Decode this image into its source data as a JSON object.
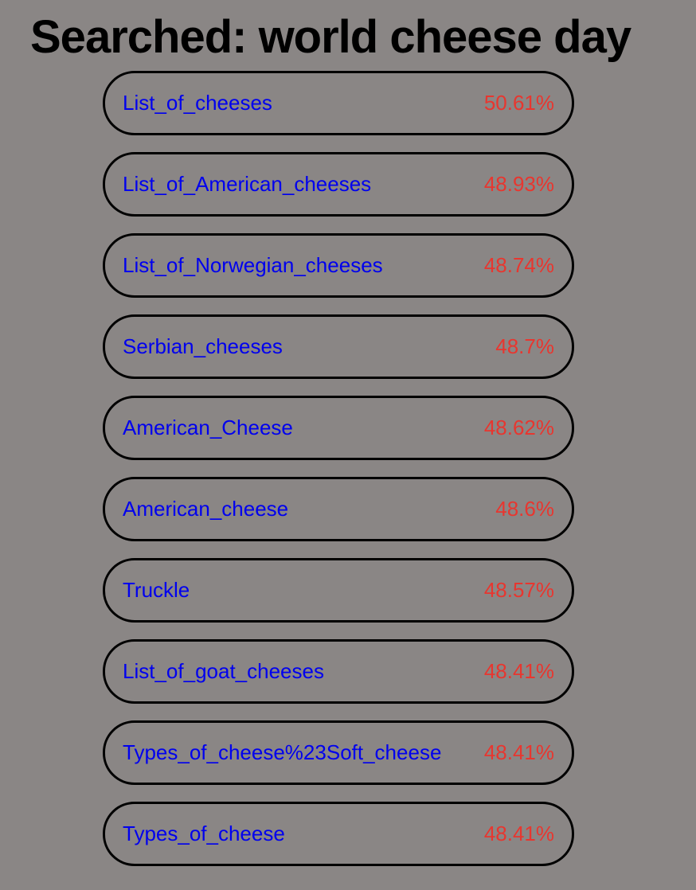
{
  "header": {
    "title": "Searched: world cheese day"
  },
  "colors": {
    "background": "#8a8685",
    "link": "#0000ee",
    "score": "#e8362f",
    "border": "#000000"
  },
  "results": [
    {
      "title": "List_of_cheeses",
      "score": "50.61%"
    },
    {
      "title": "List_of_American_cheeses",
      "score": "48.93%"
    },
    {
      "title": "List_of_Norwegian_cheeses",
      "score": "48.74%"
    },
    {
      "title": "Serbian_cheeses",
      "score": "48.7%"
    },
    {
      "title": "American_Cheese",
      "score": "48.62%"
    },
    {
      "title": "American_cheese",
      "score": "48.6%"
    },
    {
      "title": "Truckle",
      "score": "48.57%"
    },
    {
      "title": "List_of_goat_cheeses",
      "score": "48.41%"
    },
    {
      "title": "Types_of_cheese%23Soft_cheese",
      "score": "48.41%"
    },
    {
      "title": "Types_of_cheese",
      "score": "48.41%"
    }
  ]
}
